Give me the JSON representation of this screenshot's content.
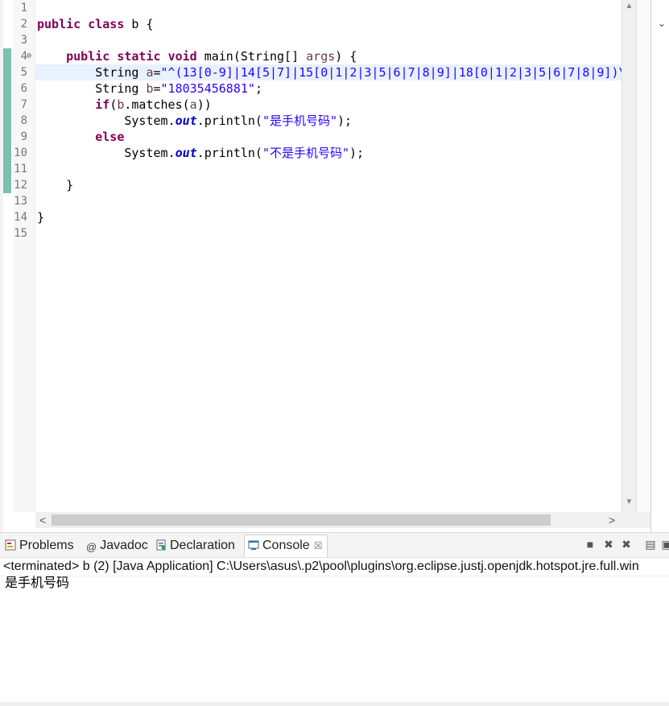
{
  "editor": {
    "line_numbers": [
      "1",
      "2",
      "3",
      "4",
      "5",
      "6",
      "7",
      "8",
      "9",
      "10",
      "11",
      "12",
      "13",
      "14",
      "15"
    ],
    "code": {
      "l2_kw1": "public",
      "l2_kw2": "class",
      "l2_rest": " b {",
      "l4_kw1": "public",
      "l4_kw2": "static",
      "l4_kw3": "void",
      "l4_a": " main(String[] ",
      "l4_param": "args",
      "l4_b": ") {",
      "l5_a": "String ",
      "l5_param": "a",
      "l5_eq": "=",
      "l5_str": "\"^(13[0-9]|14[5|7]|15[0|1|2|3|5|6|7|8|9]|18[0|1|2|3|5|6|7|8|9])\\",
      "l6_a": "String ",
      "l6_param": "b",
      "l6_eq": "=",
      "l6_str": "\"18035456881\"",
      "l6_end": ";",
      "l7_kw": "if",
      "l7_a": "(",
      "l7_p1": "b",
      "l7_b": ".matches(",
      "l7_p2": "a",
      "l7_c": "))",
      "l8_a": "System.",
      "l8_fld": "out",
      "l8_b": ".println(",
      "l8_str": "\"是手机号码\"",
      "l8_c": ");",
      "l9_kw": "else",
      "l10_a": "System.",
      "l10_fld": "out",
      "l10_b": ".println(",
      "l10_str": "\"不是手机号码\"",
      "l10_c": ");",
      "l12": "}",
      "l14": "}"
    },
    "fold_marker": "⊖"
  },
  "bottom_tabs": [
    {
      "label": "Problems",
      "icon": "problems-icon"
    },
    {
      "label": "Javadoc",
      "icon": "javadoc-icon",
      "glyph": "@"
    },
    {
      "label": "Declaration",
      "icon": "declaration-icon"
    },
    {
      "label": "Console",
      "icon": "console-icon",
      "active": true,
      "close": "☒"
    }
  ],
  "console": {
    "path": "<terminated> b (2) [Java Application] C:\\Users\\asus\\.p2\\pool\\plugins\\org.eclipse.justj.openjdk.hotspot.jre.full.win",
    "output": "是手机号码"
  },
  "colors": {
    "keyword": "#7f0055",
    "string": "#2a00ff",
    "param": "#6a3e3e",
    "field": "#0000c0",
    "current_line": "#e8f2fe",
    "change_ruler": "#7fbfb0"
  }
}
